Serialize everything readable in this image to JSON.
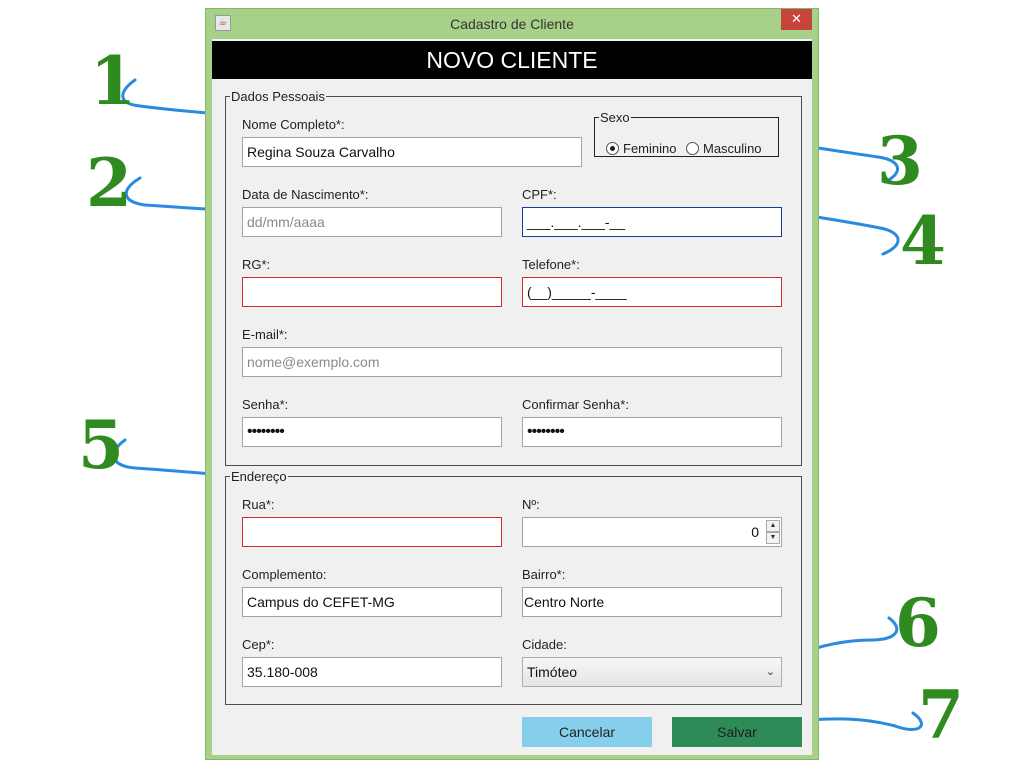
{
  "window": {
    "title": "Cadastro de Cliente",
    "close_label": "✕",
    "icon_glyph": "☕"
  },
  "header": {
    "title": "NOVO CLIENTE"
  },
  "dados_pessoais": {
    "legend": "Dados Pessoais",
    "nome": {
      "label": "Nome Completo*:",
      "value": "Regina Souza Carvalho"
    },
    "sexo": {
      "legend": "Sexo",
      "options": [
        "Feminino",
        "Masculino"
      ],
      "selected": "Feminino"
    },
    "data_nascimento": {
      "label": "Data de Nascimento*:",
      "placeholder": "dd/mm/aaaa"
    },
    "cpf": {
      "label": "CPF*:",
      "mask": "___.___.___-__"
    },
    "rg": {
      "label": "RG*:",
      "value": ""
    },
    "telefone": {
      "label": "Telefone*:",
      "mask": "(__)_____-____"
    },
    "email": {
      "label": "E-mail*:",
      "placeholder": "nome@exemplo.com"
    },
    "senha": {
      "label": "Senha*:",
      "value": "••••••••"
    },
    "confirmar_senha": {
      "label": "Confirmar Senha*:",
      "value": "••••••••"
    }
  },
  "endereco": {
    "legend": "Endereço",
    "rua": {
      "label": "Rua*:",
      "value": ""
    },
    "numero": {
      "label": "Nº:",
      "value": "0"
    },
    "complemento": {
      "label": "Complemento:",
      "value": "Campus do CEFET-MG"
    },
    "bairro": {
      "label": "Bairro*:",
      "value": "Centro Norte"
    },
    "cep": {
      "label": "Cep*:",
      "value": "35.180-008"
    },
    "cidade": {
      "label": "Cidade:",
      "selected": "Timóteo"
    }
  },
  "buttons": {
    "cancel": "Cancelar",
    "save": "Salvar"
  },
  "annotations": [
    "1",
    "2",
    "3",
    "4",
    "5",
    "6",
    "7"
  ],
  "colors": {
    "window_frame": "#a7d088",
    "cancel_button": "#86cfea",
    "save_button": "#2e8b57",
    "annotation_number": "#2f8a1f",
    "annotation_arrow": "#2a8ae0",
    "error_border": "#d12b2b"
  }
}
